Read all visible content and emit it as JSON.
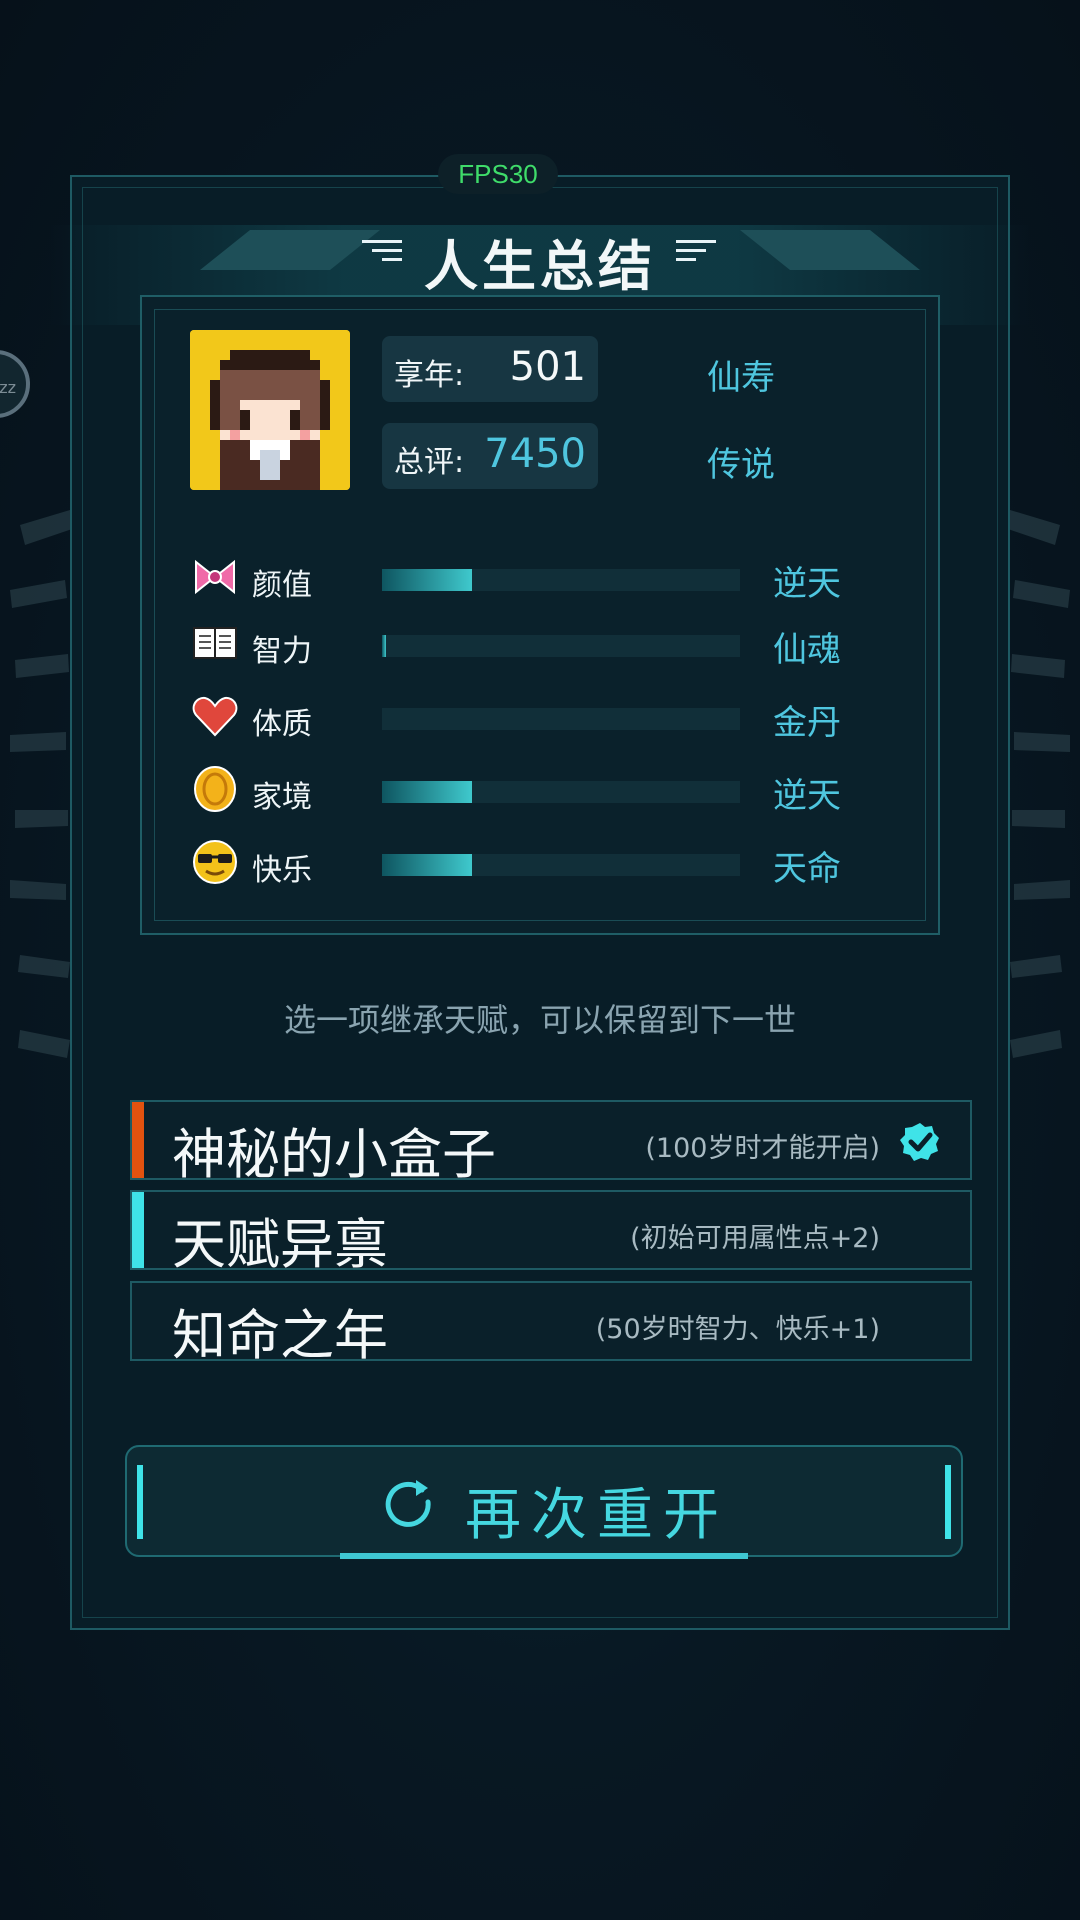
{
  "status": {
    "fps": "FPS30"
  },
  "title": "人生总结",
  "summary": {
    "lifespan": {
      "label": "享年:",
      "value": "501",
      "grade": "仙寿"
    },
    "score": {
      "label": "总评:",
      "value": "7450",
      "grade": "传说"
    }
  },
  "attributes": [
    {
      "icon": "bow-icon",
      "label": "颜值",
      "level": 0.25,
      "grade": "逆天"
    },
    {
      "icon": "book-icon",
      "label": "智力",
      "level": 0.01,
      "grade": "仙魂"
    },
    {
      "icon": "heart-icon",
      "label": "体质",
      "level": 0.0,
      "grade": "金丹"
    },
    {
      "icon": "coin-icon",
      "label": "家境",
      "level": 0.25,
      "grade": "逆天"
    },
    {
      "icon": "sunglasses-icon",
      "label": "快乐",
      "level": 0.25,
      "grade": "天命"
    }
  ],
  "hint": "选一项继承天赋，可以保留到下一世",
  "talents": [
    {
      "name": "神秘的小盒子",
      "desc": "(100岁时才能开启)",
      "selected": true,
      "accent": "#e2520f"
    },
    {
      "name": "天赋异禀",
      "desc": "(初始可用属性点+2)",
      "selected": false,
      "accent": "#3fe3e8"
    },
    {
      "name": "知命之年",
      "desc": "(50岁时智力、快乐+1)",
      "selected": false,
      "accent": ""
    }
  ],
  "restart_label": "再次重开",
  "colors": {
    "accent": "#3fe3e8",
    "grade": "#4fc6df",
    "selected_accent": "#e2520f"
  }
}
